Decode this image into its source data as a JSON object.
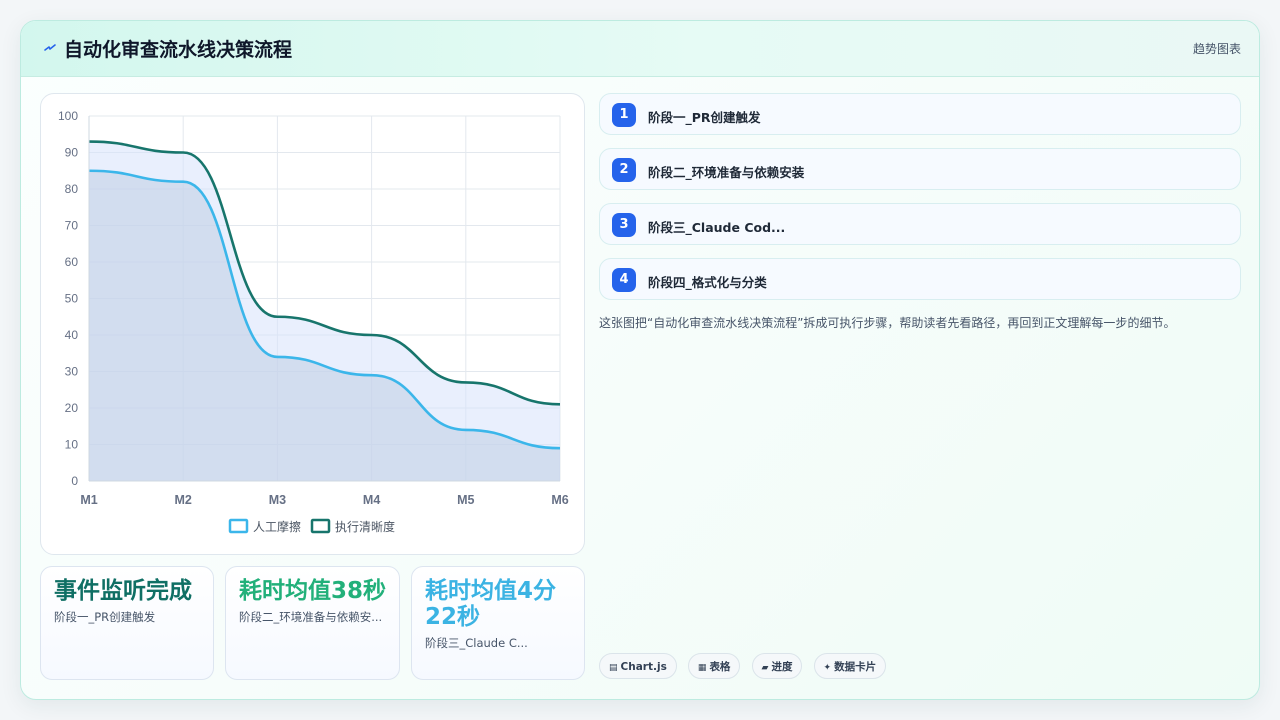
{
  "header": {
    "icon": "lightning-icon",
    "title": "自动化审查流水线决策流程",
    "action_label": "趋势图表"
  },
  "chart_data": {
    "type": "area",
    "x": [
      "M1",
      "M2",
      "M3",
      "M4",
      "M5",
      "M6"
    ],
    "ylim": [
      0,
      100
    ],
    "yticks": [
      0,
      10,
      20,
      30,
      40,
      50,
      60,
      70,
      80,
      90,
      100
    ],
    "grid": true,
    "legend_position": "bottom",
    "series": [
      {
        "name": "人工摩擦",
        "values": [
          85,
          82,
          34,
          29,
          14,
          9
        ],
        "color": "#3bb6ea",
        "fill": "rgba(191,205,228,0.55)"
      },
      {
        "name": "执行清晰度",
        "values": [
          93,
          90,
          45,
          40,
          27,
          21
        ],
        "color": "#17756c",
        "fill": "rgba(215,226,252,0.55)"
      }
    ]
  },
  "stats": [
    {
      "value": "事件监听完成",
      "sub": "阶段一_PR创建触发",
      "color": "#0f6f64"
    },
    {
      "value": "耗时均值38秒",
      "sub": "阶段二_环境准备与依赖安...",
      "color": "#22b07a"
    },
    {
      "value": "耗时均值4分22秒",
      "sub": "阶段三_Claude C...",
      "color": "#3bb3e3"
    }
  ],
  "steps": [
    {
      "num": "1",
      "label": "阶段一_PR创建触发"
    },
    {
      "num": "2",
      "label": "阶段二_环境准备与依赖安装"
    },
    {
      "num": "3",
      "label": "阶段三_Claude Cod..."
    },
    {
      "num": "4",
      "label": "阶段四_格式化与分类"
    }
  ],
  "description": "这张图把“自动化审查流水线决策流程”拆成可执行步骤，帮助读者先看路径，再回到正文理解每一步的细节。",
  "tags": [
    {
      "icon": "chart-icon",
      "glyph": "▤",
      "label": "Chart.js"
    },
    {
      "icon": "table-icon",
      "glyph": "▦",
      "label": "表格"
    },
    {
      "icon": "progress-icon",
      "glyph": "▰",
      "label": "进度"
    },
    {
      "icon": "sparkle-icon",
      "glyph": "✦",
      "label": "数据卡片"
    }
  ]
}
